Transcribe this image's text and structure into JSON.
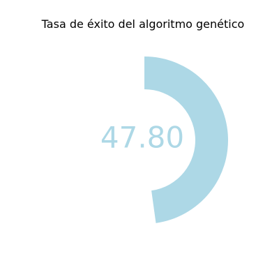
{
  "chart_data": {
    "type": "pie",
    "chart_subtype": "gauge",
    "title": "Tasa de éxito del algoritmo genético",
    "value": 47.8,
    "value_label": "47.80",
    "range": [
      0,
      100
    ],
    "start": "top",
    "direction": "clockwise",
    "grid": false,
    "legend": "none",
    "colors": {
      "arc": "#add8e6",
      "value_text": "#add8e6",
      "title": "#000000",
      "background": "#ffffff"
    }
  }
}
